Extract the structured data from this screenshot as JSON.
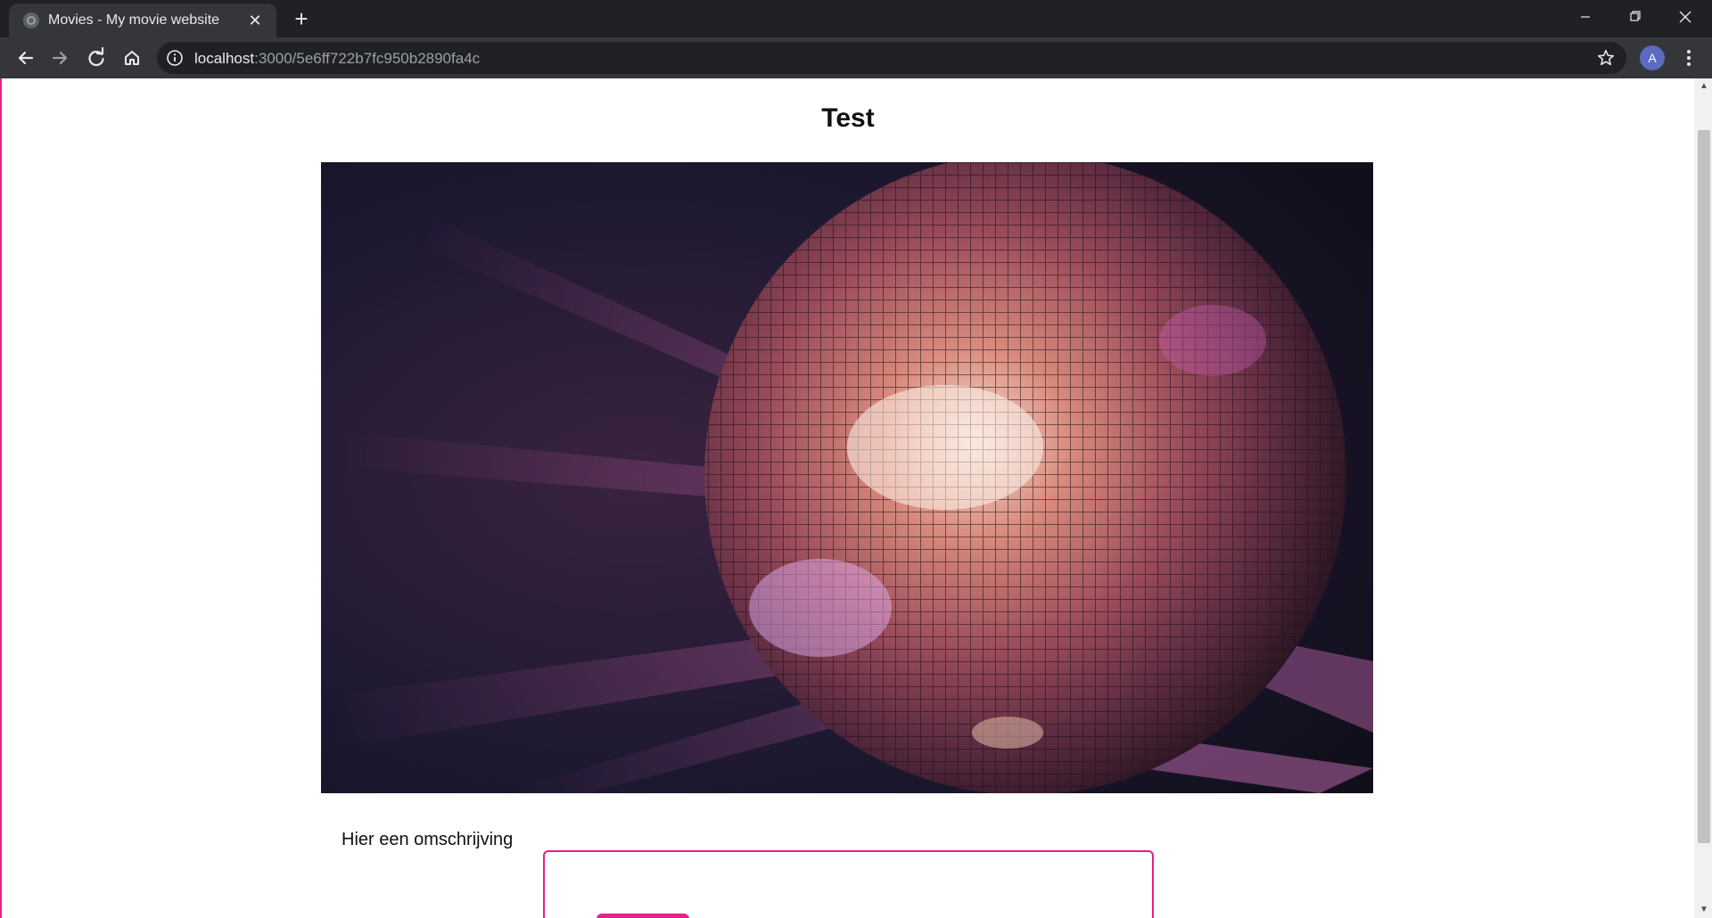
{
  "browser": {
    "tab_title": "Movies - My movie website",
    "url_host": "localhost",
    "url_path": ":3000/5e6ff722b7fc950b2890fa4c",
    "profile_initial": "A"
  },
  "page": {
    "title": "Test",
    "description_label": "Hier een omschrijving",
    "accent_color": "#e91e8c"
  },
  "icons": {
    "tab_favicon": "globe-icon",
    "back": "arrow-left-icon",
    "forward": "arrow-right-icon",
    "reload": "reload-icon",
    "home": "home-icon",
    "site_info": "info-icon",
    "bookmark": "star-icon",
    "menu": "kebab-menu-icon"
  }
}
